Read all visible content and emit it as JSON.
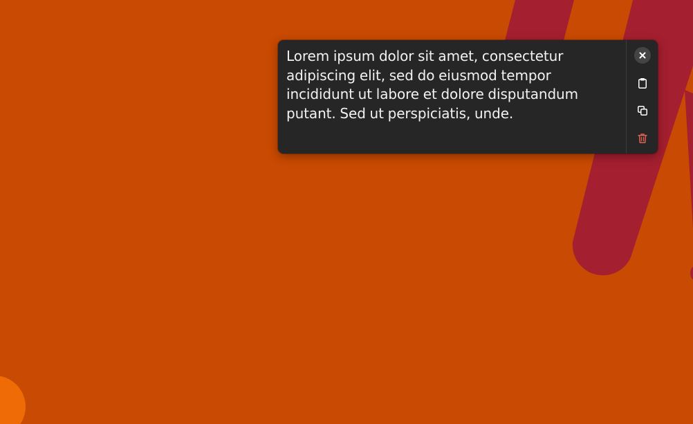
{
  "note": {
    "text": "Lorem ipsum dolor sit amet, consectetur adipiscing elit, sed do eiusmod tempor incididunt ut labore et dolore disputandum putant. Sed ut perspiciatis, unde."
  },
  "actions": [
    {
      "icon": "close-icon"
    },
    {
      "icon": "clipboard-paste-icon"
    },
    {
      "icon": "copy-icon"
    },
    {
      "icon": "trash-icon"
    }
  ],
  "colors": {
    "wallpaper": "#c94a02",
    "stripe": "#a41f2f",
    "accent_blob": "#ef6b05",
    "card": "#262626",
    "text": "#f2f2f2",
    "delete": "#e0614f"
  }
}
